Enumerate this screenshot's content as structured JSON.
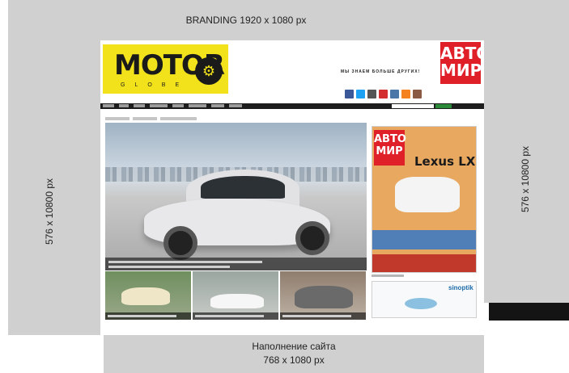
{
  "zones": {
    "top_label": "BRANDING 1920 x 1080 px",
    "left_label": "576 x 10800 px",
    "right_label": "576 x 10800 px",
    "bottom_label_line1": "Наполнение сайта",
    "bottom_label_line2": "768 x 1080 px"
  },
  "site": {
    "logo_main": "MOTOR",
    "logo_sub": "GLOBE",
    "slogan": "МЫ ЗНАЕМ БОЛЬШЕ ДРУГИХ!",
    "magazine_logo_line1": "АВТО",
    "magazine_logo_line2": "МИР",
    "cover_title": "Lexus LX",
    "weather_logo": "sinoptik"
  },
  "colors": {
    "zone_gray": "#d0d0d0",
    "logo_yellow": "#f2e21b",
    "brand_red": "#e02028",
    "nav_dark": "#1d1d1d"
  },
  "social_icons": [
    "facebook-icon",
    "twitter-icon",
    "google-plus-icon",
    "youtube-icon",
    "vk-icon",
    "odnoklassniki-icon",
    "instagram-icon"
  ]
}
